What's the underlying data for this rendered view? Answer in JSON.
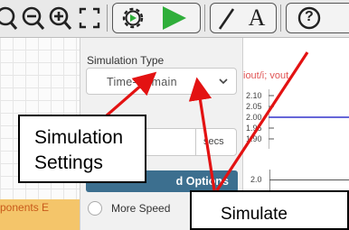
{
  "toolbar": {
    "icons": [
      "search-left-partial-icon",
      "zoom-out-icon",
      "zoom-in-icon",
      "fit-screen-icon",
      "gear-icon",
      "play-icon",
      "pen-icon",
      "text-icon",
      "help-icon"
    ],
    "text_tool_glyph": "A",
    "help_glyph": "?"
  },
  "panel": {
    "title": "Simulation Type",
    "select_value": "Time-Domain",
    "unit_label": "secs",
    "advanced_button": "Advanced Options",
    "advanced_button_visible": "d Options",
    "more_speed_label": "More Speed"
  },
  "plot": {
    "title": "iout/i; vout",
    "ticks": [
      "2.10",
      "2.05",
      "2.00",
      "1.95",
      "1.90"
    ],
    "lower_tick": "2.0",
    "accent": "#3333cc"
  },
  "components_tab": {
    "label": "ponents E"
  },
  "callouts": {
    "sim_settings_line1": "Simulation",
    "sim_settings_line2": "Settings",
    "simulate": "Simulate"
  },
  "colors": {
    "arrow": "#e31212",
    "advanced_button_bg": "#3c6f8f",
    "components_tab_bg": "#f4c56a",
    "play_green": "#2fae3a"
  }
}
